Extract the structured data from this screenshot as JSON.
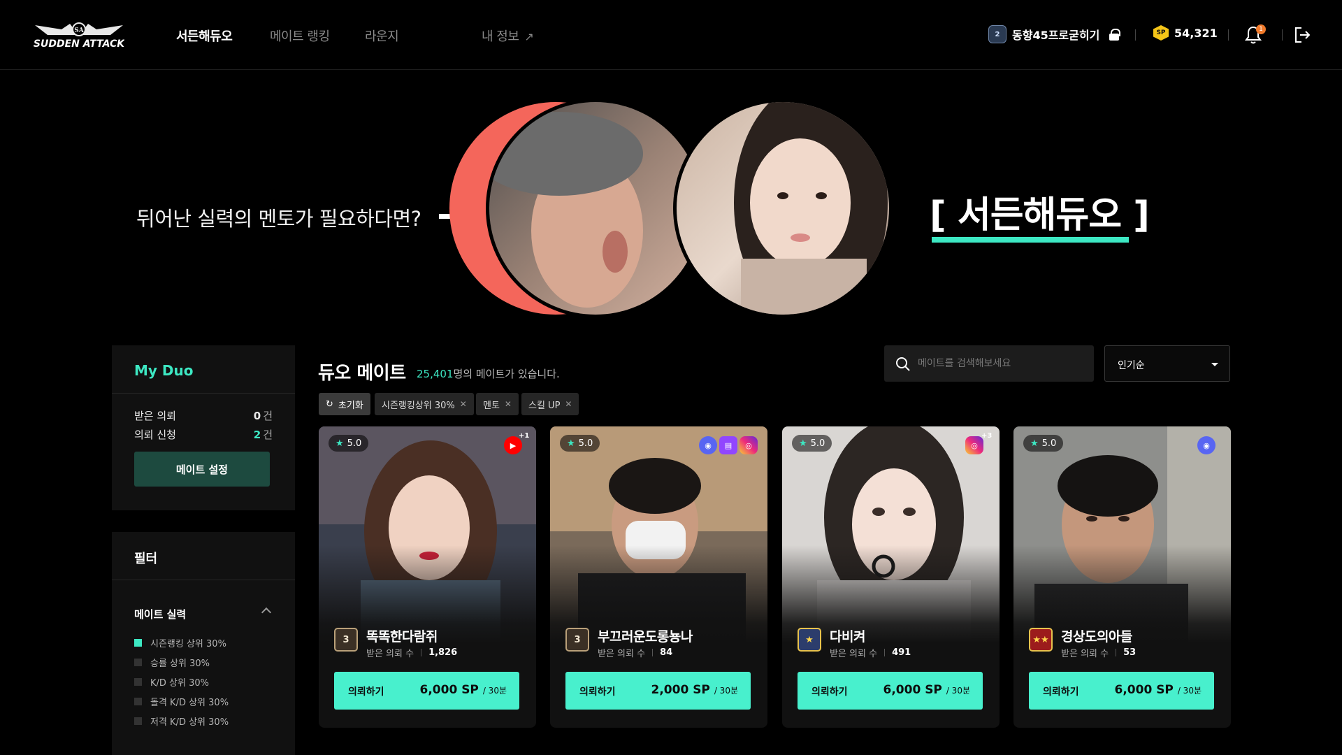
{
  "header": {
    "logo_text": "SUDDEN ATTACK",
    "nav": [
      "서든해듀오",
      "메이트 랭킹",
      "라운지",
      "내 정보"
    ],
    "nav_external_icon": "external-link-icon",
    "user": {
      "rank_icon": "rank-badge-icon",
      "rank_mark": "2",
      "nickname": "동향45프로굳히기",
      "lock_icon": "lock-icon"
    },
    "sp": {
      "icon": "sp-coin-icon",
      "coin_text": "SP",
      "amount": "54,321"
    },
    "notifications": {
      "icon": "bell-icon",
      "count": "1"
    },
    "logout_icon": "logout-icon"
  },
  "hero": {
    "tagline": "뒤어난 실력의 멘토가 필요하다면?",
    "title": "[ 서든해듀오 ]",
    "accent": "#3de8c3",
    "coral": "#f4665b"
  },
  "sidebar": {
    "my_duo": {
      "title": "My Duo",
      "received_label": "받은 의뢰",
      "received_value": "0",
      "requested_label": "의뢰 신청",
      "requested_value": "2",
      "unit": "건",
      "settings_button": "메이트 설정"
    },
    "filter": {
      "title": "필터",
      "group_title": "메이트 실력",
      "options": [
        {
          "label": "시즌랭킹 상위 30%",
          "checked": true
        },
        {
          "label": "승률 상위 30%",
          "checked": false
        },
        {
          "label": "K/D 상위 30%",
          "checked": false
        },
        {
          "label": "돌격 K/D 상위 30%",
          "checked": false
        },
        {
          "label": "저격 K/D 상위 30%",
          "checked": false
        }
      ]
    }
  },
  "main": {
    "title": "듀오 메이트",
    "count": "25,401",
    "count_suffix": "명의 메이트가 있습니다.",
    "search_placeholder": "메이트를 검색해보세요",
    "sort_value": "인기순",
    "reset_chip": "초기화",
    "chips": [
      "시즌랭킹상위 30%",
      "멘토",
      "스킬 UP"
    ],
    "request_button": "의뢰하기",
    "received_label": "받은 의뢰 수",
    "per_unit": "/ 30분",
    "cards": [
      {
        "name": "똑똑한다람쥐",
        "rating": "5.0",
        "tier": "3",
        "requests": "1,826",
        "price": "6,000 SP",
        "sns": [
          "youtube"
        ],
        "sns_more": "+1"
      },
      {
        "name": "부끄러운도롱뇽나",
        "rating": "5.0",
        "tier": "3",
        "requests": "84",
        "price": "2,000 SP",
        "sns": [
          "discord",
          "twitch",
          "instagram"
        ],
        "sns_more": ""
      },
      {
        "name": "다비켜",
        "rating": "5.0",
        "tier": "★",
        "requests": "491",
        "price": "6,000 SP",
        "sns": [
          "instagram"
        ],
        "sns_more": "+3"
      },
      {
        "name": "경상도의아들",
        "rating": "5.0",
        "tier": "★★",
        "requests": "53",
        "price": "6,000 SP",
        "sns": [
          "discord"
        ],
        "sns_more": ""
      }
    ]
  }
}
